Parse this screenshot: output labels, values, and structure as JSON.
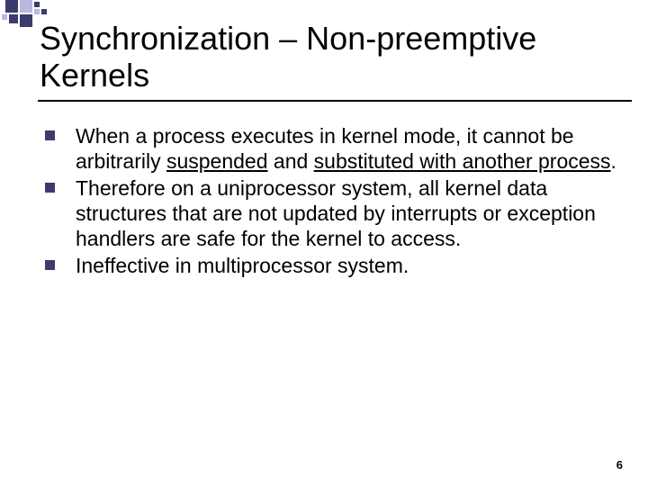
{
  "deco": {
    "colors": {
      "dark": "#3b3b6d",
      "light": "#b8b8e0"
    }
  },
  "title": "Synchronization – Non-preemptive Kernels",
  "bullets": [
    {
      "pre": "When a process executes in kernel mode, it cannot be arbitrarily ",
      "u1": "suspended",
      "mid": " and ",
      "u2": "substituted with another process",
      "post": "."
    },
    {
      "pre": "Therefore on a uniprocessor system, all kernel data structures that are not updated by interrupts or exception handlers are safe for the kernel to access.",
      "u1": "",
      "mid": "",
      "u2": "",
      "post": ""
    },
    {
      "pre": "Ineffective in multiprocessor system.",
      "u1": "",
      "mid": "",
      "u2": "",
      "post": ""
    }
  ],
  "page_number": "6"
}
